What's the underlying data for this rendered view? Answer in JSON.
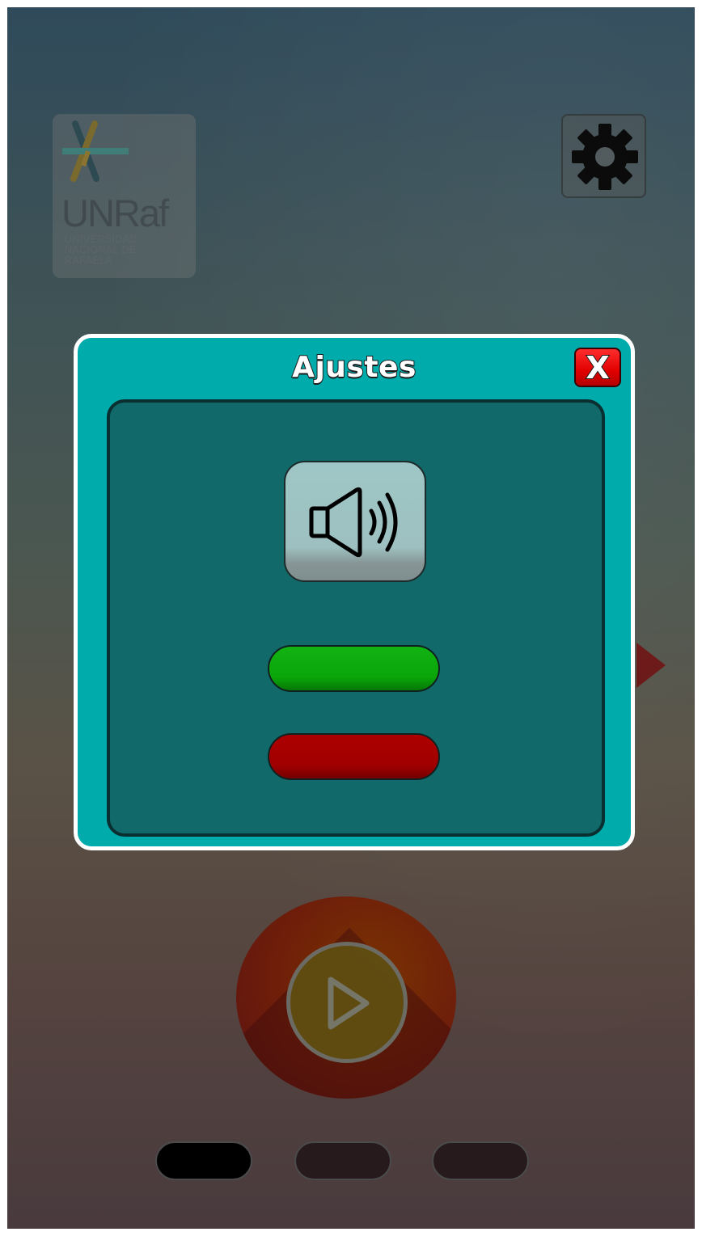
{
  "logo": {
    "title": "UNRaf",
    "subtitle": "UNIVERSIDAD NACIONAL DE RAFAELA",
    "icon": "unraf-logo"
  },
  "header": {
    "settings_icon": "gear-icon"
  },
  "settings_modal": {
    "title": "Ajustes",
    "close_label": "X",
    "sound_icon": "speaker-icon",
    "sound_on_color": "#0aa50a",
    "sound_off_color": "#a00000"
  },
  "main": {
    "play_icon": "play-icon",
    "page_indicators": 3,
    "active_indicator": 1
  },
  "colors": {
    "modal_bg": "#00abab",
    "panel_bg": "#11696a",
    "close_red": "#e10000"
  }
}
